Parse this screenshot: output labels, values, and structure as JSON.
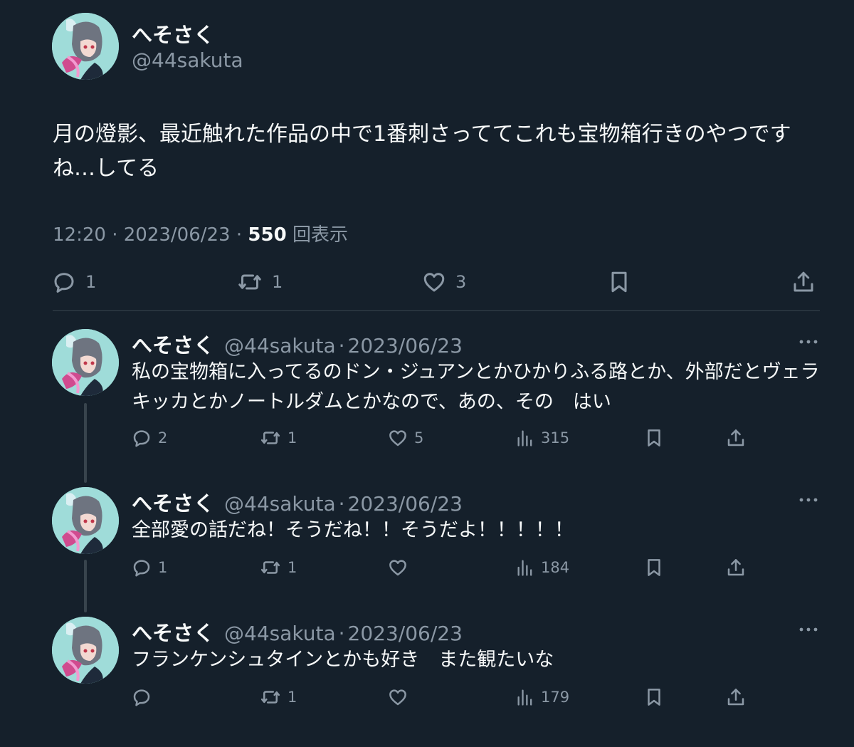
{
  "main_tweet": {
    "display_name": "へそさく",
    "handle": "@44sakuta",
    "text": "月の燈影、最近触れた作品の中で1番刺さっててこれも宝物箱行きのやつですね…してる",
    "time": "12:20",
    "date": "2023/06/23",
    "views_count": "550",
    "views_label": "回表示",
    "replies": "1",
    "retweets": "1",
    "likes": "3"
  },
  "replies": [
    {
      "display_name": "へそさく",
      "handle": "@44sakuta",
      "date": "2023/06/23",
      "text": "私の宝物箱に入ってるのドン・ジュアンとかひかりふる路とか、外部だとヴェラキッカとかノートルダムとかなので、あの、その　はい",
      "replies": "2",
      "retweets": "1",
      "likes": "5",
      "views": "315"
    },
    {
      "display_name": "へそさく",
      "handle": "@44sakuta",
      "date": "2023/06/23",
      "text": "全部愛の話だね！そうだね！！そうだよ！！！！！",
      "replies": "1",
      "retweets": "1",
      "likes": "",
      "views": "184"
    },
    {
      "display_name": "へそさく",
      "handle": "@44sakuta",
      "date": "2023/06/23",
      "text": "フランケンシュタインとかも好き　また観たいな",
      "replies": "",
      "retweets": "1",
      "likes": "",
      "views": "179"
    }
  ],
  "icons": {
    "reply": "reply-icon",
    "retweet": "retweet-icon",
    "like": "heart-icon",
    "views": "views-icon",
    "bookmark": "bookmark-icon",
    "share": "share-icon",
    "more": "more-icon"
  },
  "colors": {
    "background": "#15202b",
    "primary_text": "#f7f9f9",
    "secondary_text": "#8b98a5",
    "divider": "#38444d"
  }
}
